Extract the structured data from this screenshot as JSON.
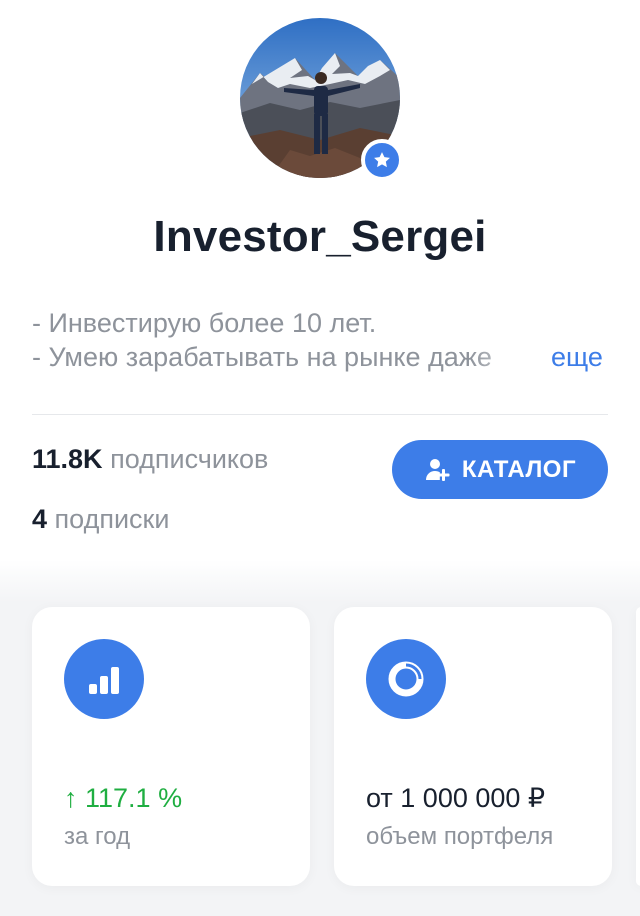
{
  "profile": {
    "username": "Investor_Sergei",
    "bio_lines": [
      "- Инвестирую более 10 лет.",
      "- Умею зарабатывать на рынке даже"
    ],
    "more_label": "еще"
  },
  "stats": {
    "followers_count": "11.8K",
    "followers_label": "подписчиков",
    "following_count": "4",
    "following_label": "подписки"
  },
  "catalog_button": {
    "label": "КАТАЛОГ",
    "icon": "add-user-icon"
  },
  "cards": [
    {
      "icon": "bar-chart-icon",
      "value": "↑ 117.1 %",
      "label": "за год",
      "value_color": "#1fae41"
    },
    {
      "icon": "pie-chart-icon",
      "value": "от 1 000 000 ₽",
      "label": "объем портфеля"
    }
  ],
  "colors": {
    "accent": "#3d7de8",
    "positive": "#1fae41",
    "muted_text": "#8e939b",
    "text": "#18202e"
  }
}
